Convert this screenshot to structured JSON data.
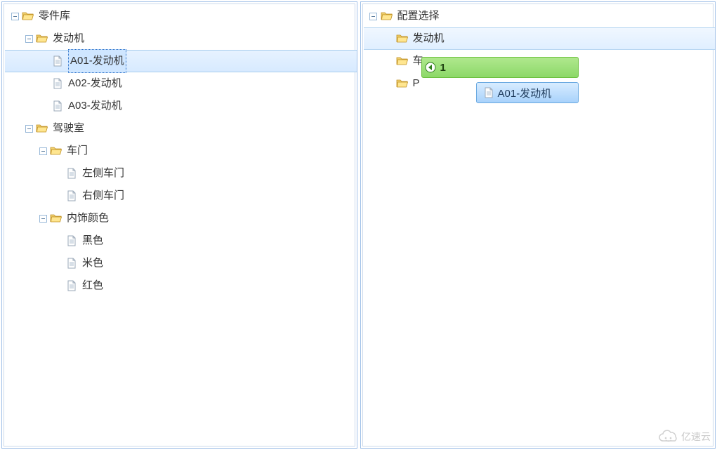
{
  "left": {
    "root": "零件库",
    "engine_folder": "发动机",
    "engine_items": [
      "A01-发动机",
      "A02-发动机",
      "A03-发动机"
    ],
    "selected_index": 0,
    "cab_folder": "驾驶室",
    "door_folder": "车门",
    "door_items": [
      "左侧车门",
      "右侧车门"
    ],
    "color_folder": "内饰颜色",
    "color_items": [
      "黑色",
      "米色",
      "红色"
    ]
  },
  "right": {
    "root": "配置选择",
    "engine_folder": "发动机",
    "partial1": "车",
    "partial2": "P",
    "drag_count": "1",
    "drag_label": "A01-发动机"
  },
  "watermark": "亿速云"
}
